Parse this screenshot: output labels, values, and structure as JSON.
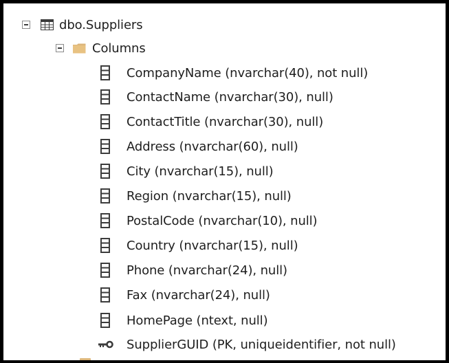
{
  "tree": {
    "table": {
      "label": "dbo.Suppliers",
      "icon": "table-icon",
      "expanded": true
    },
    "columns_folder": {
      "label": "Columns",
      "icon": "folder-icon",
      "expanded": true
    },
    "columns": [
      {
        "label": "CompanyName (nvarchar(40), not null)",
        "icon": "column-icon"
      },
      {
        "label": "ContactName (nvarchar(30), null)",
        "icon": "column-icon"
      },
      {
        "label": "ContactTitle (nvarchar(30), null)",
        "icon": "column-icon"
      },
      {
        "label": "Address (nvarchar(60), null)",
        "icon": "column-icon"
      },
      {
        "label": "City (nvarchar(15), null)",
        "icon": "column-icon"
      },
      {
        "label": "Region (nvarchar(15), null)",
        "icon": "column-icon"
      },
      {
        "label": "PostalCode (nvarchar(10), null)",
        "icon": "column-icon"
      },
      {
        "label": "Country (nvarchar(15), null)",
        "icon": "column-icon"
      },
      {
        "label": "Phone (nvarchar(24), null)",
        "icon": "column-icon"
      },
      {
        "label": "Fax (nvarchar(24), null)",
        "icon": "column-icon"
      },
      {
        "label": "HomePage (ntext, null)",
        "icon": "column-icon"
      },
      {
        "label": "SupplierGUID (PK, uniqueidentifier, not null)",
        "icon": "key-icon"
      }
    ]
  },
  "colors": {
    "text": "#1e1e1e",
    "folder": "#dcb67a",
    "icon_dark": "#3c3c3c",
    "border": "#000000"
  }
}
